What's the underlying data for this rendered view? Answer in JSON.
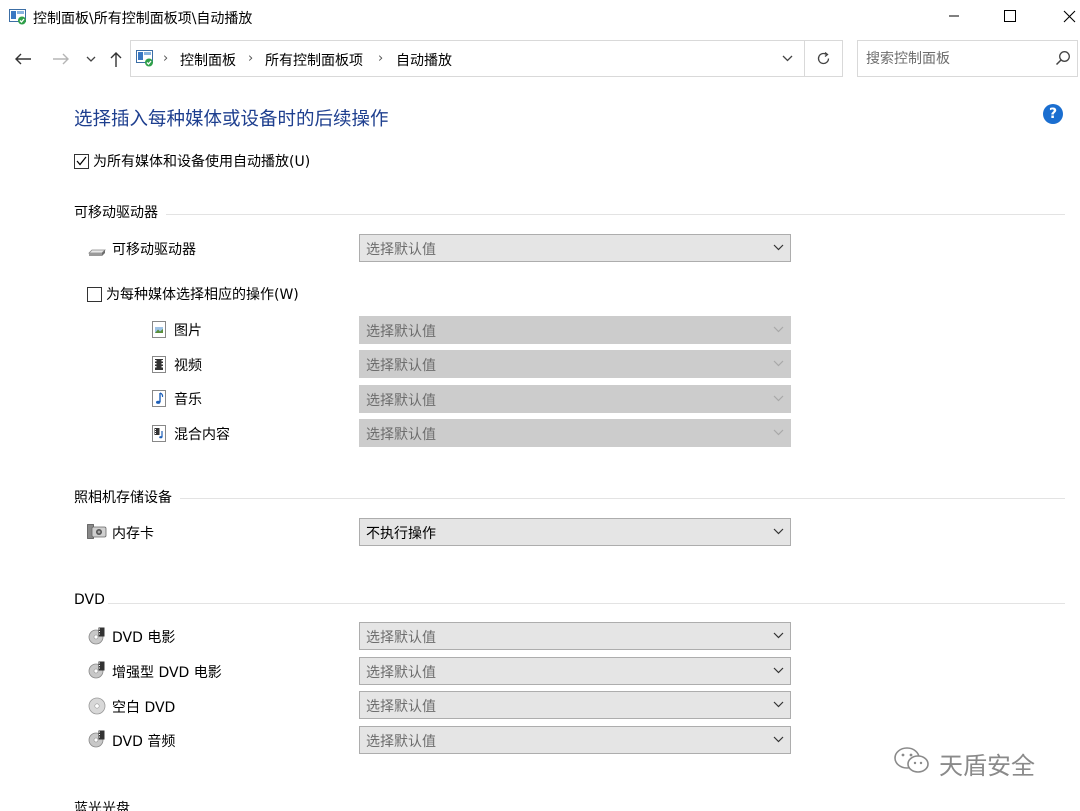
{
  "window": {
    "title": "控制面板\\所有控制面板项\\自动播放",
    "minimize_glyph": "—",
    "maximize_glyph": "☐",
    "close_glyph": "✕"
  },
  "nav": {
    "back_icon": "arrow-left-icon",
    "forward_icon": "arrow-right-icon",
    "recent_icon": "chevron-down-icon",
    "up_icon": "arrow-up-icon"
  },
  "address": {
    "crumbs": [
      "控制面板",
      "所有控制面板项",
      "自动播放"
    ]
  },
  "search": {
    "placeholder": "搜索控制面板"
  },
  "content": {
    "heading": "选择插入每种媒体或设备时的后续操作",
    "use_autoplay_label": "为所有媒体和设备使用自动播放(U)",
    "use_autoplay_checked": true
  },
  "removable": {
    "section_title": "可移动驱动器",
    "drive_label": "可移动驱动器",
    "drive_value": "选择默认值",
    "per_media_label": "为每种媒体选择相应的操作(W)",
    "per_media_checked": false,
    "media": [
      {
        "label": "图片",
        "value": "选择默认值",
        "icon": "picture-icon"
      },
      {
        "label": "视频",
        "value": "选择默认值",
        "icon": "video-icon"
      },
      {
        "label": "音乐",
        "value": "选择默认值",
        "icon": "music-icon"
      },
      {
        "label": "混合内容",
        "value": "选择默认值",
        "icon": "mixed-content-icon"
      }
    ]
  },
  "camera": {
    "section_title": "照相机存储设备",
    "card_label": "内存卡",
    "card_value": "不执行操作"
  },
  "dvd": {
    "section_title": "DVD",
    "items": [
      {
        "label": "DVD 电影",
        "value": "选择默认值"
      },
      {
        "label": "增强型 DVD 电影",
        "value": "选择默认值"
      },
      {
        "label": "空白 DVD",
        "value": "选择默认值"
      },
      {
        "label": "DVD 音频",
        "value": "选择默认值"
      }
    ]
  },
  "bluray": {
    "section_title": "蓝光光盘"
  },
  "watermark": {
    "text": "天盾安全"
  },
  "colors": {
    "heading": "#1e3f8f",
    "help": "#1a6ed0",
    "combo_bg": "#e5e5e5",
    "combo_disabled_bg": "#cccccc"
  }
}
